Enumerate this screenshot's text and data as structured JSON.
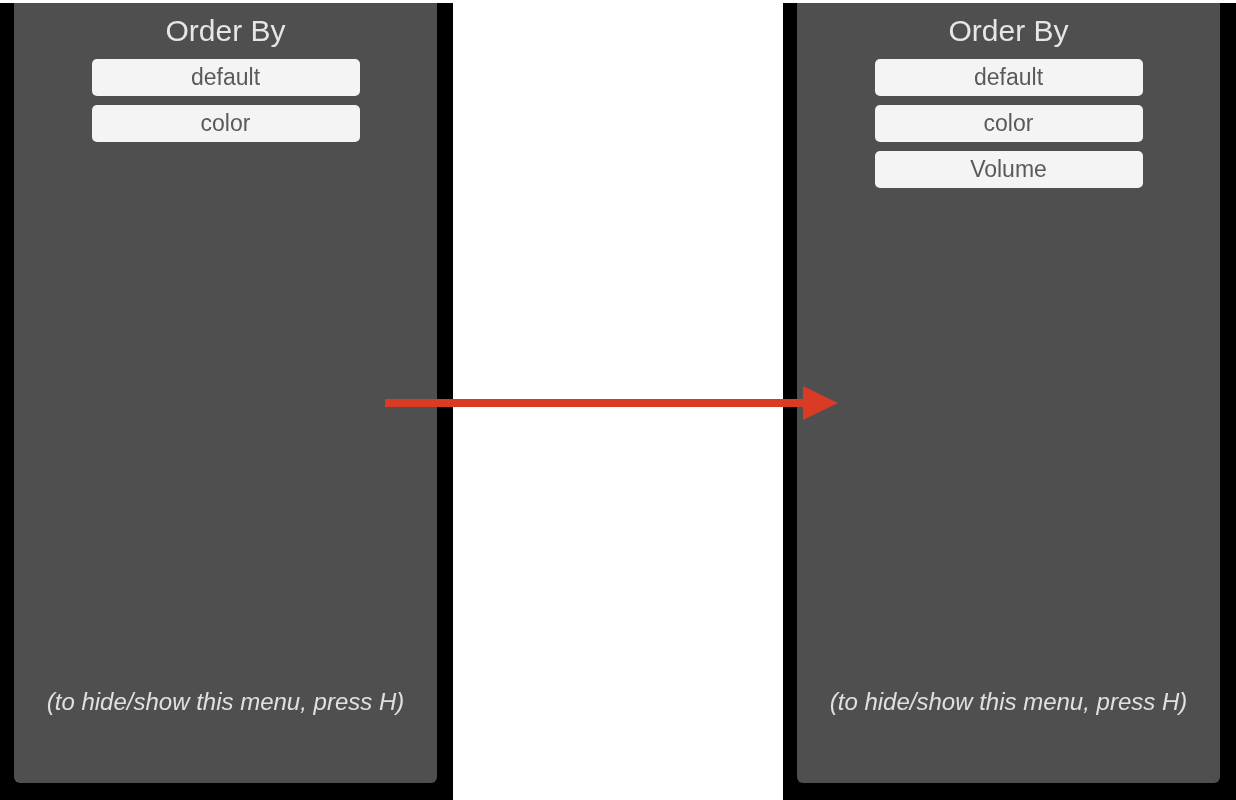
{
  "panels": [
    {
      "title": "Order By",
      "buttons": [
        "default",
        "color"
      ],
      "hint": "(to hide/show this menu, press H)"
    },
    {
      "title": "Order By",
      "buttons": [
        "default",
        "color",
        "Volume"
      ],
      "hint": "(to hide/show this menu, press H)"
    }
  ]
}
